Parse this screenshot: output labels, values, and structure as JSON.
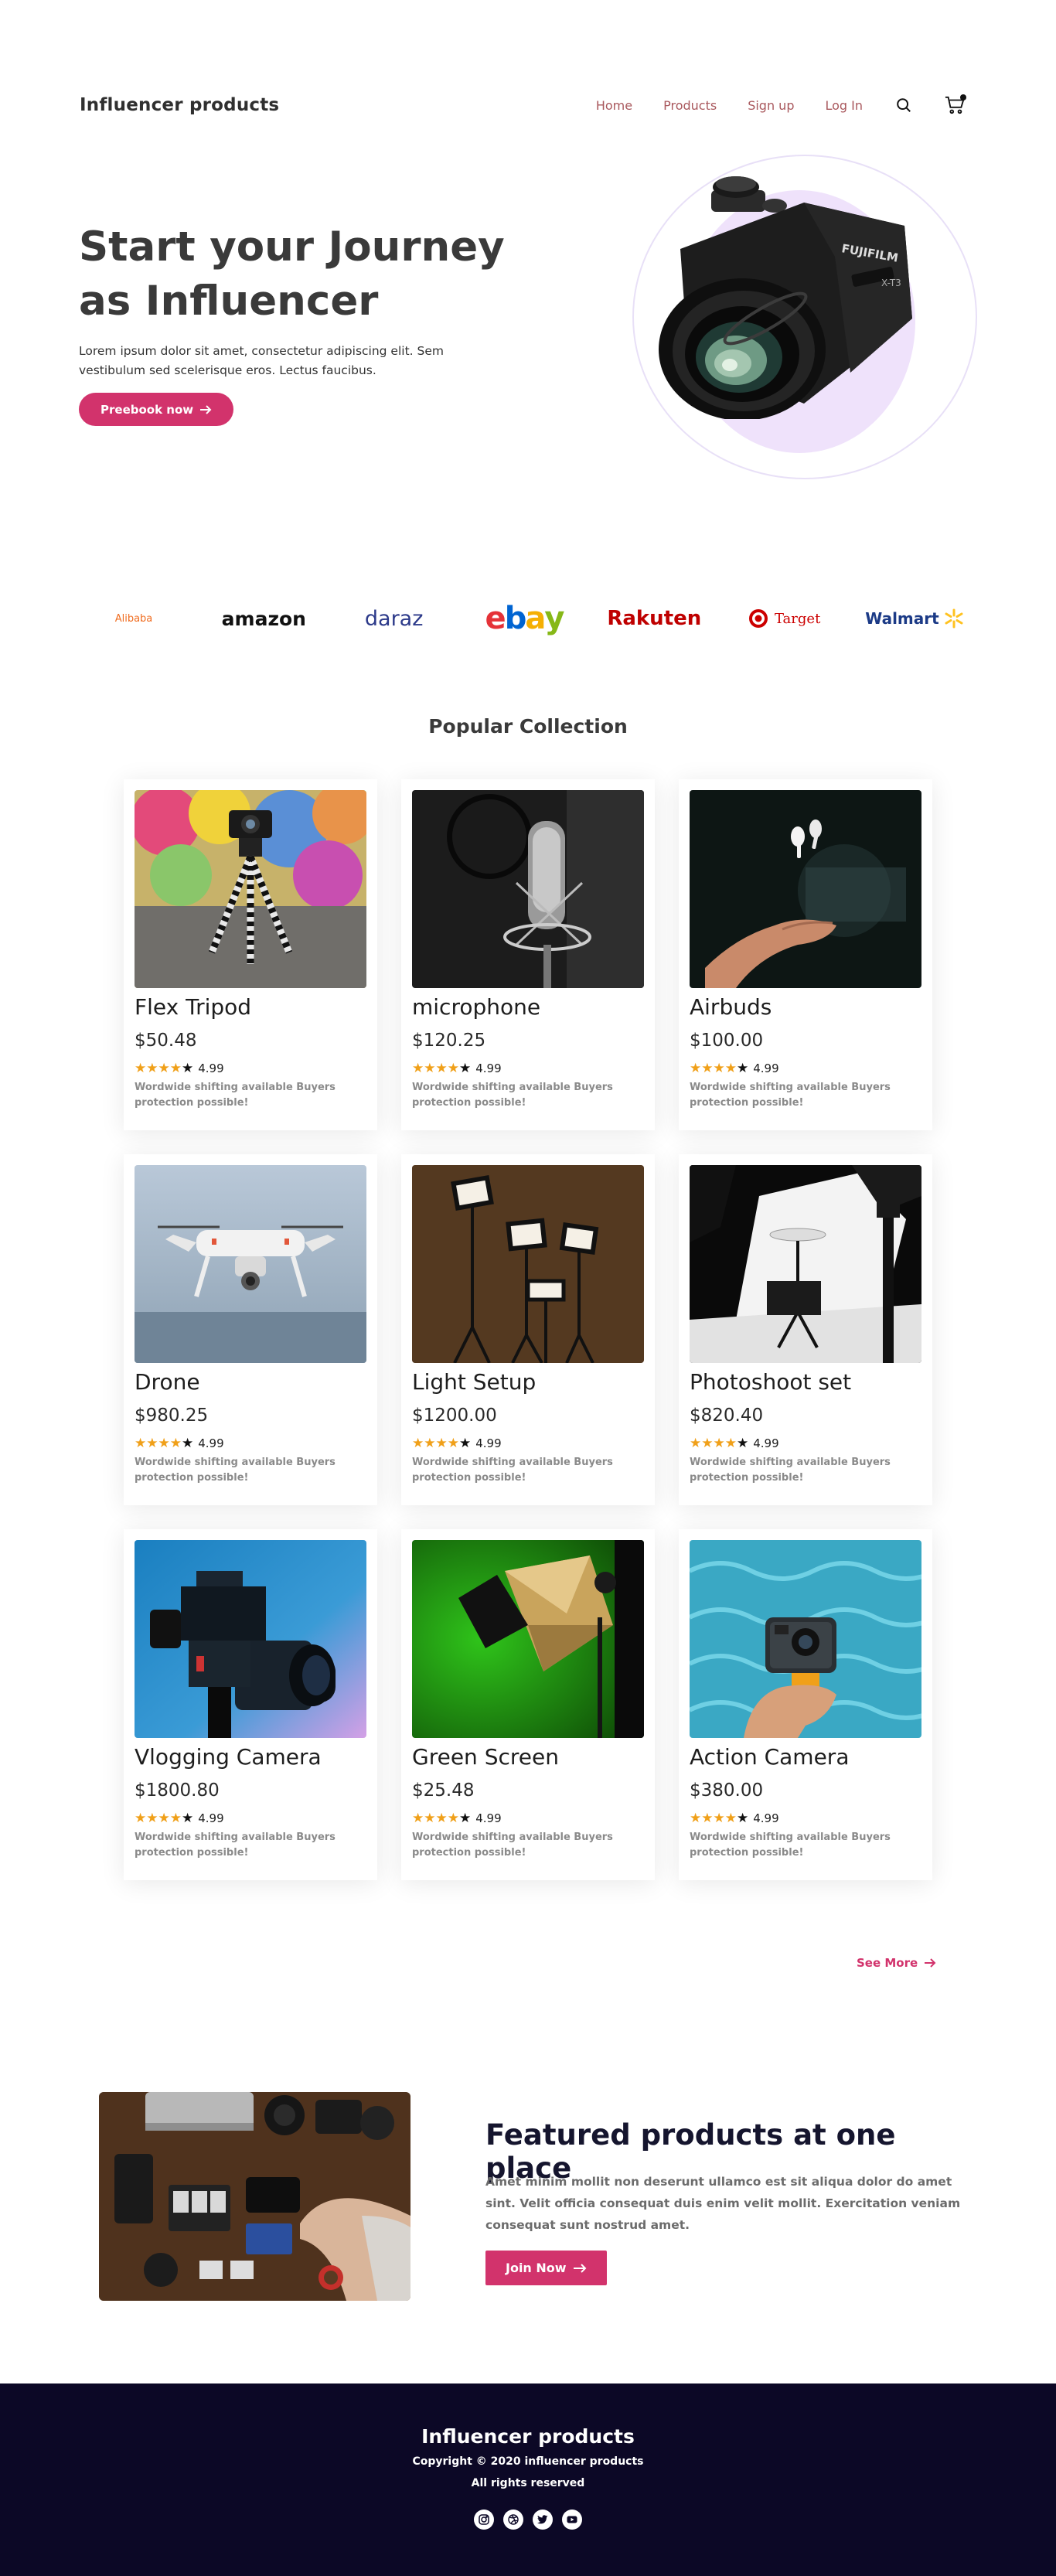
{
  "nav": {
    "brand": "Influencer products",
    "links": [
      "Home",
      "Products",
      "Sign up",
      "Log In"
    ],
    "icons": [
      "search-icon",
      "cart-icon"
    ]
  },
  "hero": {
    "title": "Start your Journey as Influencer",
    "text": "Lorem ipsum dolor sit amet, consectetur adipiscing elit. Sem vestibulum sed scelerisque eros. Lectus faucibus.",
    "button": "Preebook now",
    "button_icon": "arrow-right-icon",
    "image": "camera-image"
  },
  "brands": {
    "alibaba": "Alibaba",
    "amazon": "amazon",
    "daraz": "daraz",
    "ebay": [
      "e",
      "b",
      "a",
      "y"
    ],
    "rakuten": "Rakuten",
    "target": "Target",
    "walmart": "Walmart"
  },
  "collection": {
    "title": "Popular Collection",
    "products": [
      {
        "name": "Flex Tripod",
        "price": "$50.48",
        "rating": "4.99",
        "stars": 4,
        "desc": "Wordwide shifting available Buyers protection possible!"
      },
      {
        "name": "microphone",
        "price": "$120.25",
        "rating": "4.99",
        "stars": 4,
        "desc": "Wordwide shifting available Buyers protection possible!"
      },
      {
        "name": "Airbuds",
        "price": "$100.00",
        "rating": "4.99",
        "stars": 4,
        "desc": "Wordwide shifting available Buyers protection possible!"
      },
      {
        "name": "Drone",
        "price": "$980.25",
        "rating": "4.99",
        "stars": 4,
        "desc": "Wordwide shifting available Buyers protection possible!"
      },
      {
        "name": "Light Setup",
        "price": "$1200.00",
        "rating": "4.99",
        "stars": 4,
        "desc": "Wordwide shifting available Buyers protection possible!"
      },
      {
        "name": "Photoshoot set",
        "price": "$820.40",
        "rating": "4.99",
        "stars": 4,
        "desc": "Wordwide shifting available Buyers protection possible!"
      },
      {
        "name": "Vlogging Camera",
        "price": "$1800.80",
        "rating": "4.99",
        "stars": 4,
        "desc": "Wordwide shifting available Buyers protection possible!"
      },
      {
        "name": "Green Screen",
        "price": "$25.48",
        "rating": "4.99",
        "stars": 4,
        "desc": "Wordwide shifting available Buyers protection possible!"
      },
      {
        "name": "Action Camera",
        "price": "$380.00",
        "rating": "4.99",
        "stars": 4,
        "desc": "Wordwide shifting available Buyers protection possible!"
      }
    ],
    "see_more": "See More"
  },
  "featured": {
    "title": "Featured products at one place",
    "text": "Amet minim mollit non deserunt ullamco est sit aliqua dolor do amet sint. Velit officia consequat duis enim velit mollit. Exercitation veniam consequat sunt nostrud amet.",
    "button": "Join Now"
  },
  "footer": {
    "brand": "Influencer products",
    "copyright": "Copyright © 2020 influencer products",
    "rights": "All rights reserved",
    "social": [
      "instagram-icon",
      "dribbble-icon",
      "twitter-icon",
      "youtube-icon"
    ]
  },
  "colors": {
    "accent": "#d2336c",
    "nav_link": "#a9585d",
    "star": "#f0a019",
    "footer_bg": "#0c0826",
    "hero_blob": "#efe2fb",
    "ebay": [
      "#e53238",
      "#0064d2",
      "#f5af02",
      "#86b817"
    ]
  }
}
